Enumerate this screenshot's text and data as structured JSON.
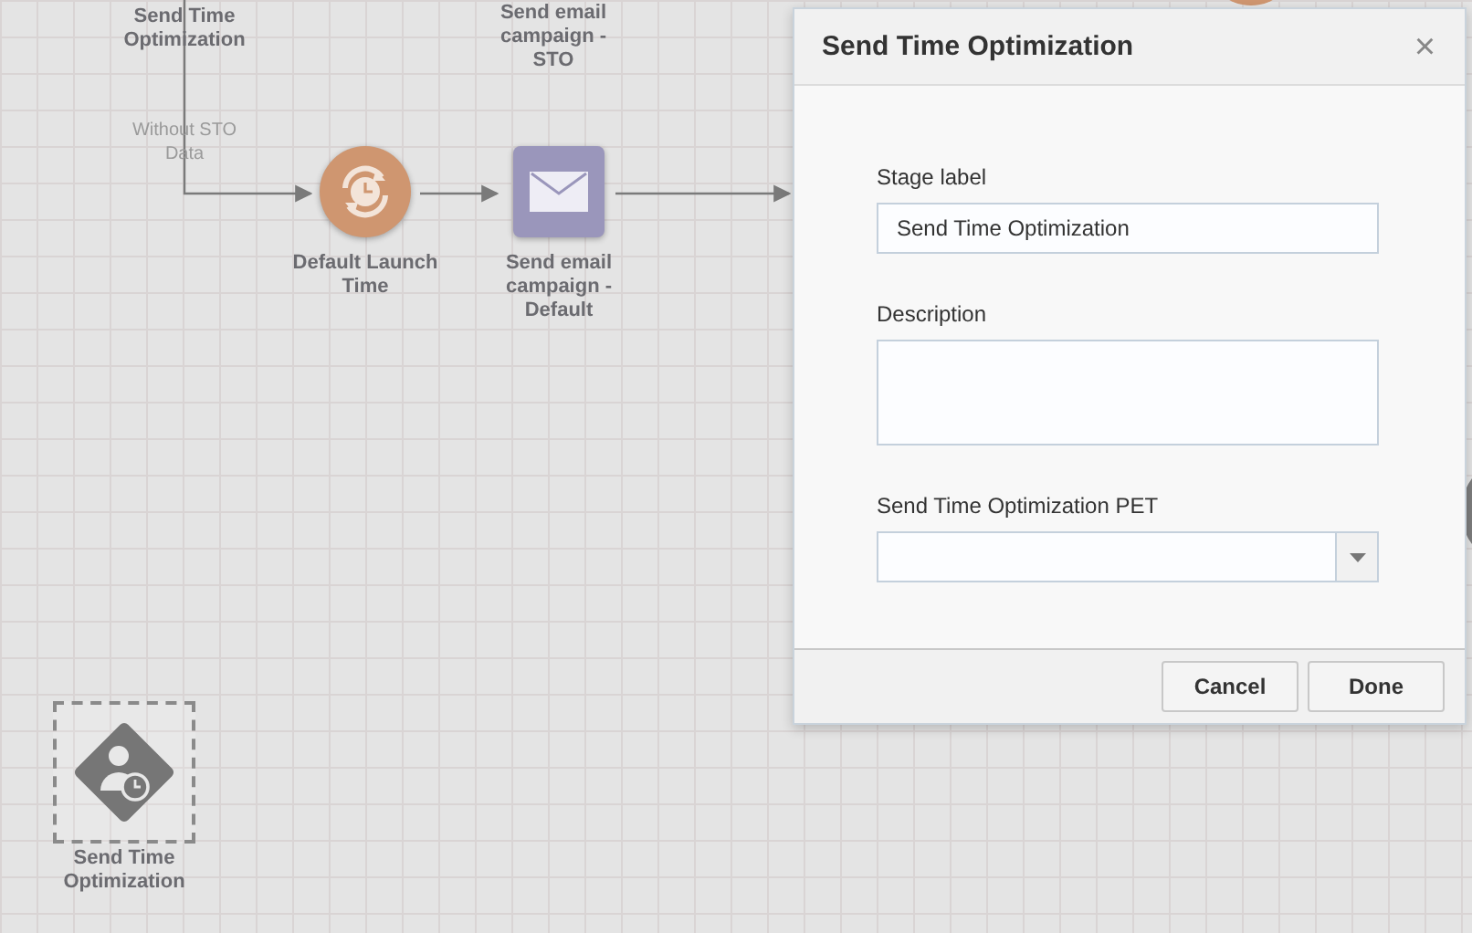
{
  "canvas": {
    "nodes": [
      {
        "kind": "label",
        "label": "Send Time Optimization"
      },
      {
        "kind": "label",
        "label": "Send email campaign - STO"
      },
      {
        "kind": "edge-label",
        "label": "Without STO Data"
      },
      {
        "kind": "timer",
        "label": "Default Launch Time"
      },
      {
        "kind": "email",
        "label": "Send email campaign - Default"
      },
      {
        "kind": "sto",
        "label": "Send Time Optimization",
        "selected": true
      }
    ]
  },
  "dialog": {
    "title": "Send Time Optimization",
    "close": "×",
    "fields": [
      {
        "kind": "text",
        "label": "Stage label",
        "value": "Send Time Optimization"
      },
      {
        "kind": "textarea",
        "label": "Description"
      },
      {
        "kind": "select",
        "label": "Send Time Optimization PET"
      }
    ],
    "buttons": [
      "Cancel",
      "Done"
    ]
  }
}
